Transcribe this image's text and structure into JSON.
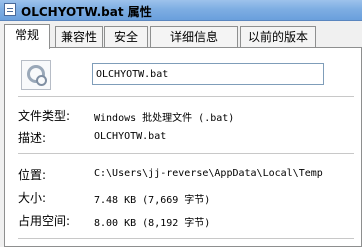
{
  "window": {
    "title": "OLCHYOTW.bat 属性"
  },
  "tabs": [
    {
      "label": "常规"
    },
    {
      "label": "兼容性"
    },
    {
      "label": "安全"
    },
    {
      "label": "详细信息"
    },
    {
      "label": "以前的版本"
    }
  ],
  "general": {
    "file_name": "OLCHYOTW.bat",
    "file_type_label": "文件类型:",
    "file_type_value": "Windows 批处理文件 (.bat)",
    "description_label": "描述:",
    "description_value": "OLCHYOTW.bat",
    "location_label": "位置:",
    "location_value": "C:\\Users\\jj-reverse\\AppData\\Local\\Temp",
    "size_label": "大小:",
    "size_value": "7.48 KB (7,669 字节)",
    "size_on_disk_label": "占用空间:",
    "size_on_disk_value": "8.00 KB (8,192 字节)"
  }
}
